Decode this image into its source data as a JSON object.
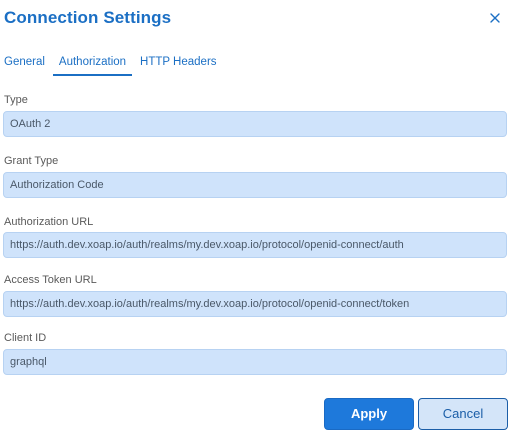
{
  "dialog": {
    "title": "Connection Settings"
  },
  "tabs": [
    {
      "label": "General",
      "active": false
    },
    {
      "label": "Authorization",
      "active": true
    },
    {
      "label": "HTTP Headers",
      "active": false
    }
  ],
  "fields": {
    "type": {
      "label": "Type",
      "value": "OAuth 2"
    },
    "grant_type": {
      "label": "Grant Type",
      "value": "Authorization Code"
    },
    "authorization_url": {
      "label": "Authorization URL",
      "value": "https://auth.dev.xoap.io/auth/realms/my.dev.xoap.io/protocol/openid-connect/auth"
    },
    "access_token_url": {
      "label": "Access Token URL",
      "value": "https://auth.dev.xoap.io/auth/realms/my.dev.xoap.io/protocol/openid-connect/token"
    },
    "client_id": {
      "label": "Client ID",
      "value": "graphql"
    }
  },
  "buttons": {
    "apply": "Apply",
    "cancel": "Cancel"
  },
  "colors": {
    "accent": "#1b6fc4",
    "input_bg": "#cfe3fb",
    "apply_bg": "#1e79db"
  },
  "icons": {
    "close": "close-icon"
  }
}
